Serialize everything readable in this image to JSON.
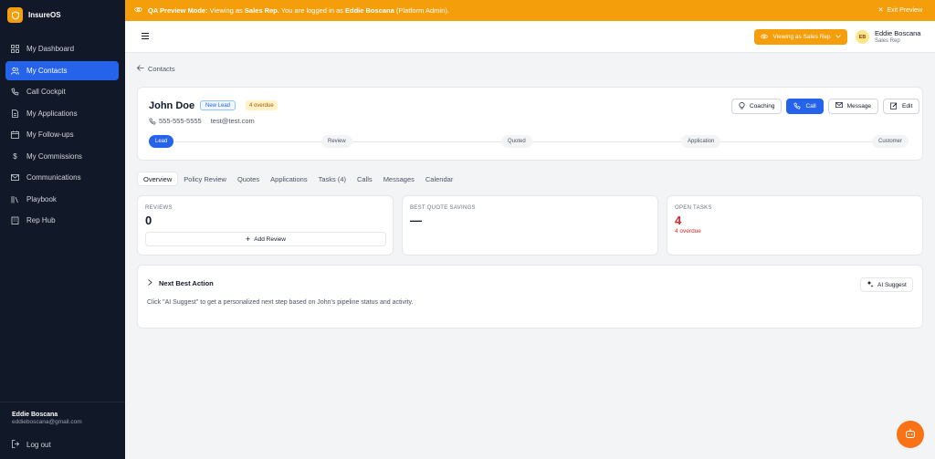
{
  "app": {
    "name": "InsureOS"
  },
  "sidebar": {
    "items": [
      {
        "label": "My Dashboard",
        "icon": "dashboard-icon"
      },
      {
        "label": "My Contacts",
        "icon": "users-icon",
        "active": true
      },
      {
        "label": "Call Cockpit",
        "icon": "phone-icon"
      },
      {
        "label": "My Applications",
        "icon": "file-icon"
      },
      {
        "label": "My Follow-ups",
        "icon": "calendar-icon"
      },
      {
        "label": "My Commissions",
        "icon": "dollar-icon"
      },
      {
        "label": "Communications",
        "icon": "mail-icon"
      },
      {
        "label": "Playbook",
        "icon": "library-icon"
      },
      {
        "label": "Rep Hub",
        "icon": "building-icon"
      }
    ],
    "user": {
      "name": "Eddie Boscana",
      "email": "eddieboscana@gmail.com"
    },
    "logout_label": "Log out"
  },
  "banner": {
    "mode_label": "QA Preview Mode:",
    "text_prefix": "Viewing as",
    "role": "Sales Rep.",
    "text_mid": "You are logged in as",
    "user": "Eddie Boscana",
    "suffix": "(Platform Admin).",
    "exit_label": "Exit Preview"
  },
  "header": {
    "viewing_label": "Viewing as Sales Rep",
    "avatar_initials": "EB",
    "user_name": "Eddie Boscana",
    "user_role": "Sales Rep"
  },
  "back_label": "Contacts",
  "contact": {
    "name": "John Doe",
    "status_badge": "New Lead",
    "overdue_badge": "4 overdue",
    "phone": "555-555-5555",
    "email": "test@test.com",
    "actions": {
      "coaching": "Coaching",
      "call": "Call",
      "message": "Message",
      "edit": "Edit"
    },
    "pipeline": [
      "Lead",
      "Review",
      "Quoted",
      "Application",
      "Customer"
    ],
    "pipeline_active": 0
  },
  "tabs": [
    "Overview",
    "Policy Review",
    "Quotes",
    "Applications",
    "Tasks (4)",
    "Calls",
    "Messages",
    "Calendar"
  ],
  "stats": {
    "reviews": {
      "label": "REVIEWS",
      "value": "0",
      "button": "Add Review"
    },
    "savings": {
      "label": "BEST QUOTE SAVINGS",
      "value": "—"
    },
    "tasks": {
      "label": "OPEN TASKS",
      "value": "4",
      "sub": "4 overdue"
    }
  },
  "next_action": {
    "title": "Next Best Action",
    "button": "AI Suggest",
    "description": "Click \"AI Suggest\" to get a personalized next step based on John's pipeline status and activity."
  },
  "colors": {
    "accent": "#2563eb",
    "warning": "#f59e0b",
    "sidebar_bg": "#111827",
    "danger": "#dc2626"
  }
}
